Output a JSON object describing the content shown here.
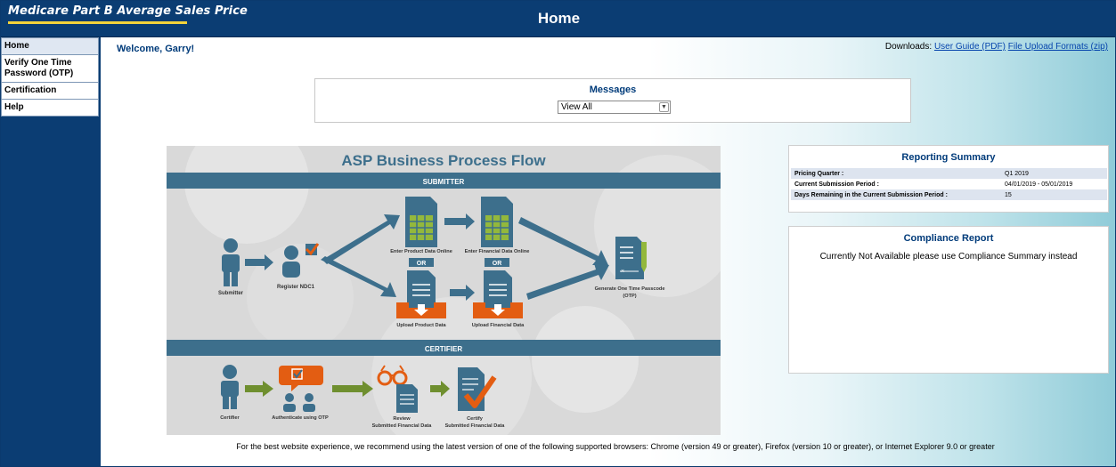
{
  "header": {
    "app_title": "Medicare Part B Average Sales Price",
    "page_title": "Home"
  },
  "sidebar": {
    "items": [
      {
        "label": "Home"
      },
      {
        "label": "Verify One Time Password (OTP)"
      },
      {
        "label": "Certification"
      },
      {
        "label": "Help"
      }
    ]
  },
  "welcome": "Welcome, Garry!",
  "downloads": {
    "prefix": "Downloads:",
    "links": [
      "User Guide (PDF)",
      "File Upload Formats (zip)"
    ]
  },
  "messages": {
    "title": "Messages",
    "selected": "View All"
  },
  "flow": {
    "title": "ASP Business Process Flow",
    "submitter_banner": "SUBMITTER",
    "certifier_banner": "CERTIFIER",
    "labels": {
      "submitter": "Submitter",
      "register": "Register NDC1",
      "enter_product": "Enter Product Data Online",
      "enter_financial": "Enter Financial Data Online",
      "or1": "OR",
      "or2": "OR",
      "upload_product": "Upload Product Data",
      "upload_financial": "Upload Financial Data",
      "generate_otp": "Generate One Time Passcode",
      "generate_otp2": "(OTP)",
      "certifier": "Certifier",
      "authenticate": "Authenticate using OTP",
      "review": "Review",
      "review2": "Submitted Financial Data",
      "certify": "Certify",
      "certify2": "Submitted Financial Data"
    }
  },
  "summary": {
    "title": "Reporting Summary",
    "rows": [
      {
        "label": "Pricing Quarter :",
        "value": "Q1 2019"
      },
      {
        "label": "Current Submission Period :",
        "value": "04/01/2019 - 05/01/2019"
      },
      {
        "label": "Days Remaining in the Current Submission Period :",
        "value": "15"
      }
    ]
  },
  "compliance": {
    "title": "Compliance Report",
    "text": "Currently Not Available please use Compliance Summary instead"
  },
  "browser_note": "For the best website experience, we recommend using the latest version of one of the following supported browsers: Chrome (version 49 or greater), Firefox (version 10 or greater), or Internet Explorer 9.0 or greater",
  "colors": {
    "header_bg": "#0b3d73",
    "accent_yellow": "#f4d33a",
    "flow_banner": "#3d6f8c",
    "flow_green": "#6f8f2f",
    "flow_orange": "#e35d12",
    "flow_icon_green": "#93b83c"
  }
}
